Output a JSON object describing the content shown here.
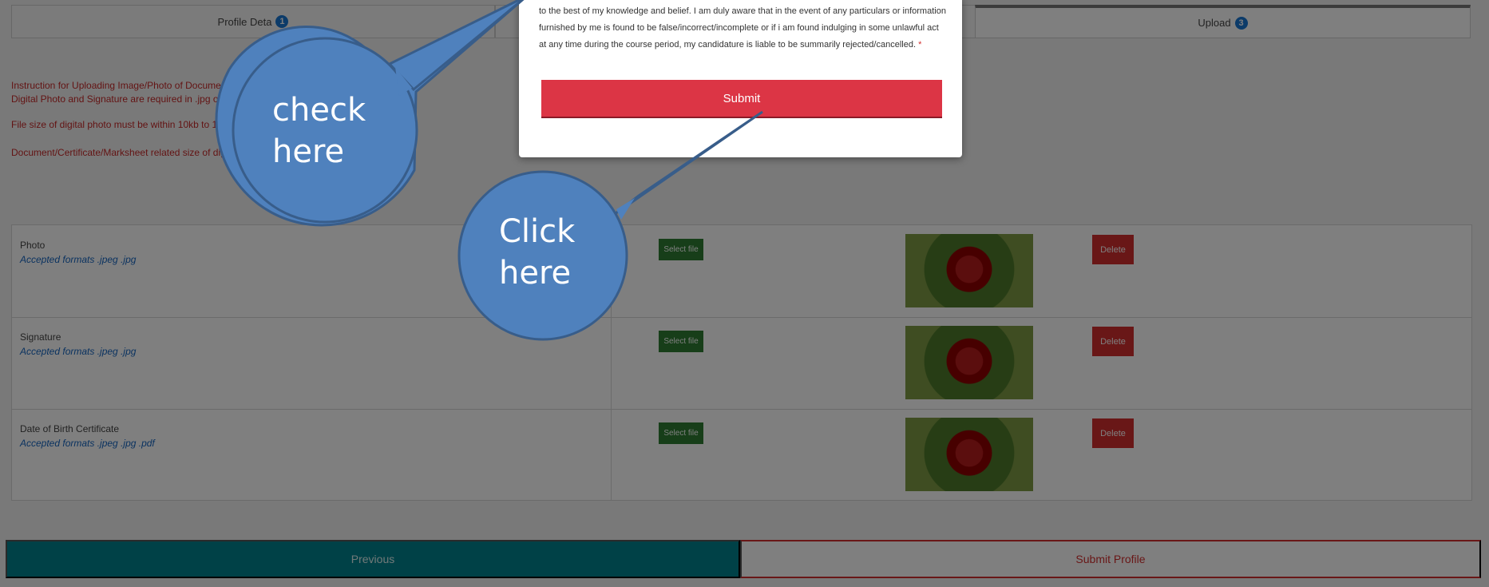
{
  "tabs": [
    {
      "label": "Profile Deta",
      "num": "1"
    },
    {
      "label": "Upload",
      "num": "3"
    }
  ],
  "instructions": [
    "Instruction for Uploading Image/Photo of Document, Cer",
    "Digital Photo and Signature are required in .jpg or .jpeg",
    "File size of digital photo must be within 10kb to 1024kb",
    "Document/Certificate/Marksheet related size of digital ph"
  ],
  "documents": [
    {
      "label": "Photo",
      "formats": "Accepted formats .jpeg .jpg",
      "select": "Select file",
      "delete": "Delete"
    },
    {
      "label": "Signature",
      "formats": "Accepted formats .jpeg .jpg",
      "select": "Select file",
      "delete": "Delete"
    },
    {
      "label": "Date of Birth Certificate",
      "formats": "Accepted formats .jpeg .jpg .pdf",
      "select": "Select file",
      "delete": "Delete"
    }
  ],
  "nav": {
    "previous": "Previous",
    "submit_profile": "Submit Profile"
  },
  "modal": {
    "declaration": "to the best of my knowledge and belief. I am duly aware that in the event of any particulars or information furnished by me is found to be false/incorrect/incomplete or if i am found indulging in some unlawful act at any time during the course period, my candidature is liable to be summarily rejected/cancelled.",
    "required_mark": "*",
    "submit": "Submit"
  },
  "callouts": {
    "check_line1": "check",
    "check_line2": "here",
    "click_line1": "Click",
    "click_line2": "here"
  },
  "colors": {
    "callout_fill": "#4f81bd",
    "callout_border": "#385d8a",
    "submit_red": "#dc3545",
    "teal": "#00838f"
  }
}
